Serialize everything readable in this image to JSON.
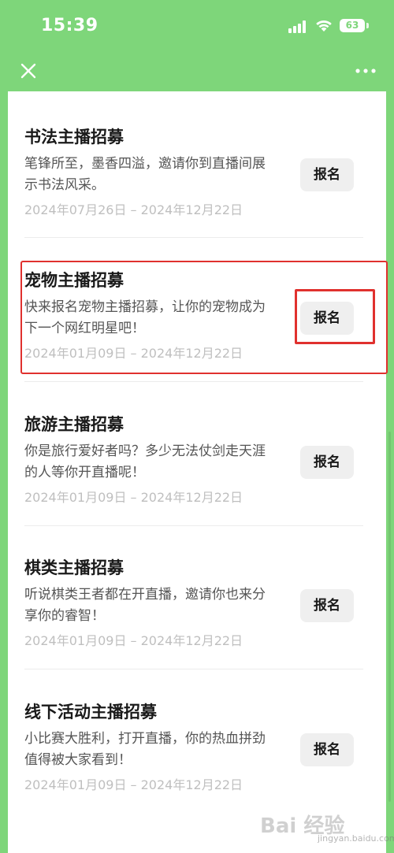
{
  "status_bar": {
    "time": "15:39",
    "battery": "63"
  },
  "items": [
    {
      "title": "书法主播招募",
      "desc": "笔锋所至，墨香四溢，邀请你到直播间展示书法风采。",
      "date": "2024年07月26日 – 2024年12月22日",
      "button": "报名"
    },
    {
      "title": "宠物主播招募",
      "desc": "快来报名宠物主播招募，让你的宠物成为下一个网红明星吧！",
      "date": "2024年01月09日 – 2024年12月22日",
      "button": "报名"
    },
    {
      "title": "旅游主播招募",
      "desc": "你是旅行爱好者吗？多少无法仗剑走天涯的人等你开直播呢！",
      "date": "2024年01月09日 – 2024年12月22日",
      "button": "报名"
    },
    {
      "title": "棋类主播招募",
      "desc": "听说棋类王者都在开直播，邀请你也来分享你的睿智！",
      "date": "2024年01月09日 – 2024年12月22日",
      "button": "报名"
    },
    {
      "title": "线下活动主播招募",
      "desc": "小比赛大胜利，打开直播，你的热血拼劲值得被大家看到！",
      "date": "2024年01月09日 – 2024年12月22日",
      "button": "报名"
    }
  ],
  "watermark": {
    "text": "Bai 经验",
    "url": "jingyan.baidu.com"
  },
  "colors": {
    "header_green": "#7ed67a",
    "highlight_red": "#e0312e"
  }
}
